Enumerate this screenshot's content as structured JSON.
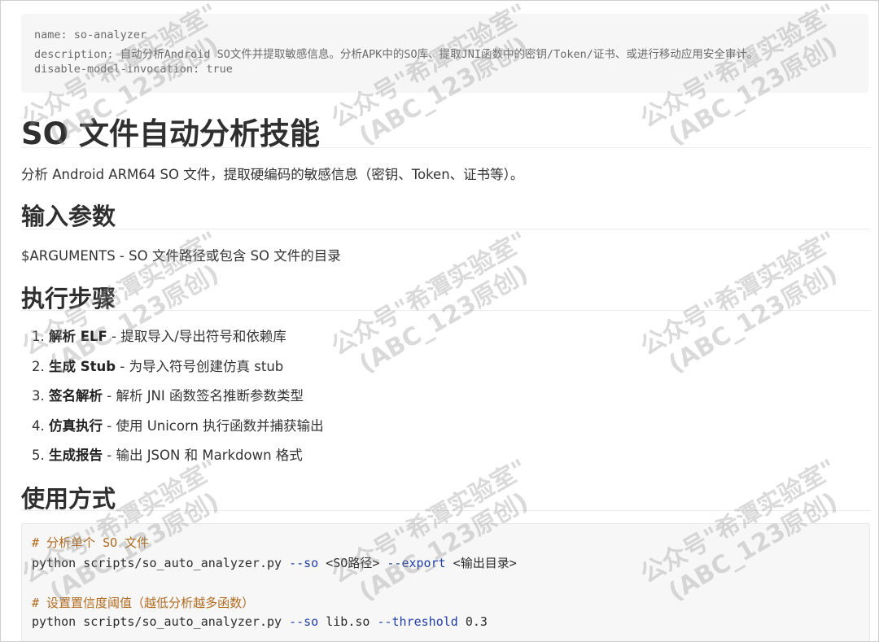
{
  "front_matter": {
    "name_line": "name: so-analyzer",
    "description_line": "description: 自动分析Android SO文件并提取敏感信息。分析APK中的SO库、提取JNI函数中的密钥/Token/证书、或进行移动应用安全审计。",
    "invocation_line": "disable-model-invocation: true"
  },
  "title": "SO 文件自动分析技能",
  "intro": "分析 Android ARM64 SO 文件，提取硬编码的敏感信息（密钥、Token、证书等）。",
  "sections": {
    "input": {
      "heading": "输入参数",
      "text": "$ARGUMENTS - SO 文件路径或包含 SO 文件的目录"
    },
    "steps": {
      "heading": "执行步骤",
      "items": [
        {
          "num": "1.",
          "bold": "解析 ELF",
          "rest": " - 提取导入/导出符号和依赖库"
        },
        {
          "num": "2.",
          "bold": "生成 Stub",
          "rest": " - 为导入符号创建仿真 stub"
        },
        {
          "num": "3.",
          "bold": "签名解析",
          "rest": " - 解析 JNI 函数签名推断参数类型"
        },
        {
          "num": "4.",
          "bold": "仿真执行",
          "rest": " - 使用 Unicorn 执行函数并捕获输出"
        },
        {
          "num": "5.",
          "bold": "生成报告",
          "rest": " - 输出 JSON 和 Markdown 格式"
        }
      ]
    },
    "usage": {
      "heading": "使用方式",
      "code": {
        "comment1": "# 分析单个 SO 文件",
        "line1_cmd": "python scripts/so_auto_analyzer.py ",
        "line1_flag1": "--so",
        "line1_arg1": " <SO路径> ",
        "line1_flag2": "--export",
        "line1_arg2": " <输出目录>",
        "comment2": "# 设置置信度阈值（越低分析越多函数）",
        "line2_cmd": "python scripts/so_auto_analyzer.py ",
        "line2_flag1": "--so",
        "line2_arg1": " lib.so ",
        "line2_flag2": "--threshold",
        "line2_arg2": " 0.3"
      }
    }
  },
  "watermark": {
    "line1": "公众号\"希潭实验室\"",
    "line2": "(ABC_123原创)"
  }
}
